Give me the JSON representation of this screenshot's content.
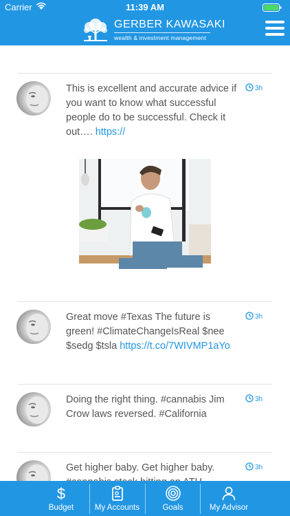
{
  "status_bar": {
    "carrier": "Carrier",
    "time": "11:39 AM"
  },
  "header": {
    "brand_name": "GERBER KAWASAKI",
    "brand_tagline": "wealth & investment management",
    "icons": [
      "tree-logo",
      "hamburger-menu-icon"
    ]
  },
  "feed": {
    "posts": [
      {
        "text": "This is excellent and accurate advice if you want to know what successful people do to be successful. Check it out…. ",
        "link": "https://",
        "time": "3h",
        "has_image": true
      },
      {
        "text": "Great move #Texas The future is green! #ClimateChangeIsReal $nee $sedg $tsla ",
        "link": "https://t.co/7WIVMP1aYo",
        "time": "3h",
        "has_image": false
      },
      {
        "text": "Doing the right thing. #cannabis Jim Crow laws reversed. #California",
        "link": "",
        "time": "3h",
        "has_image": false
      },
      {
        "text": "Get higher baby. Get higher baby. #cannabis stock hitting an ATH",
        "link": "",
        "time": "3h",
        "has_image": false
      }
    ]
  },
  "tabbar": {
    "tabs": [
      {
        "label": "Budget",
        "icon": "dollar-icon"
      },
      {
        "label": "My Accounts",
        "icon": "clipboard-icon"
      },
      {
        "label": "Goals",
        "icon": "target-icon"
      },
      {
        "label": "My Advisor",
        "icon": "person-icon"
      }
    ]
  },
  "colors": {
    "brand_blue": "#2196e3",
    "text_gray": "#555555"
  }
}
